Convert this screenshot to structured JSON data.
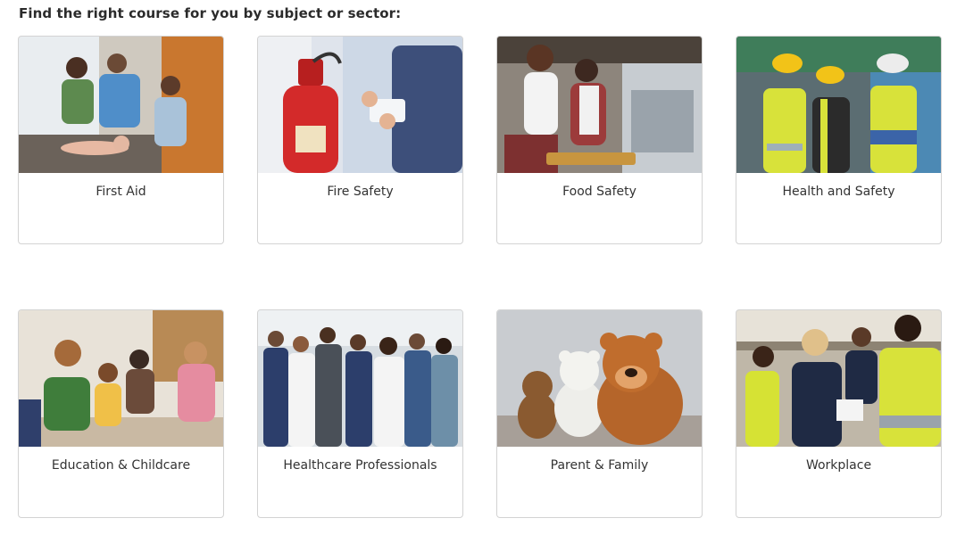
{
  "heading": "Find the right course for you by subject or sector:",
  "cards": [
    {
      "label": "First Aid",
      "image": "first-aid-photo"
    },
    {
      "label": "Fire Safety",
      "image": "fire-safety-photo"
    },
    {
      "label": "Food Safety",
      "image": "food-safety-photo"
    },
    {
      "label": "Health and Safety",
      "image": "health-safety-photo"
    },
    {
      "label": "Education & Childcare",
      "image": "education-childcare-photo"
    },
    {
      "label": "Healthcare Professionals",
      "image": "healthcare-professionals-photo"
    },
    {
      "label": "Parent & Family",
      "image": "parent-family-photo"
    },
    {
      "label": "Workplace",
      "image": "workplace-photo"
    }
  ]
}
